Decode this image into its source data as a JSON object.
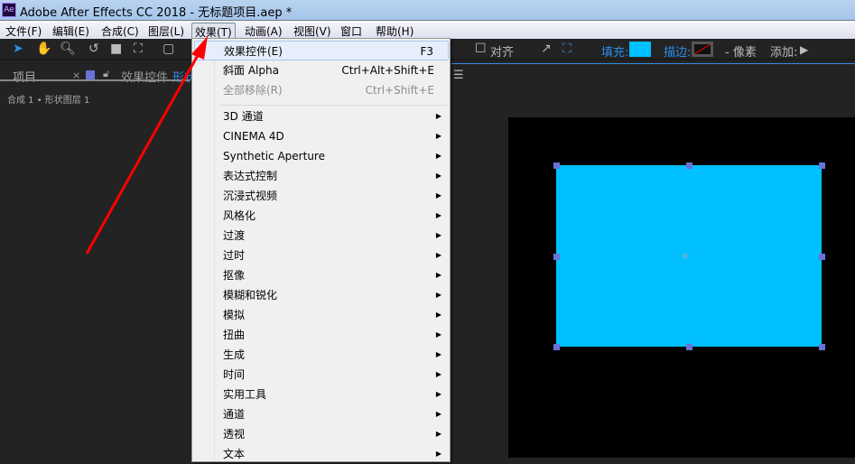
{
  "window": {
    "title": "Adobe After Effects CC 2018 - 无标题项目.aep *",
    "logo": "Ae"
  },
  "menubar": [
    "文件(F)",
    "编辑(E)",
    "合成(C)",
    "图层(L)",
    "效果(T)",
    "动画(A)",
    "视图(V)",
    "窗口",
    "帮助(H)"
  ],
  "toolbar": {
    "snap": "对齐",
    "fill_label": "填充:",
    "stroke_label": "描边:",
    "stroke_unit": "- 像素",
    "add_label": "添加:",
    "fill_color": "#00c0ff"
  },
  "panels": {
    "project_tab": "项目",
    "effects_tab": "效果控件",
    "effects_tab_layer": "形状",
    "breadcrumb": "合成 1 • 形状图层 1"
  },
  "effect_menu": {
    "top": [
      {
        "label": "效果控件(E)",
        "shortcut": "F3"
      },
      {
        "label": "斜面 Alpha",
        "shortcut": "Ctrl+Alt+Shift+E"
      },
      {
        "label": "全部移除(R)",
        "shortcut": "Ctrl+Shift+E",
        "disabled": true
      }
    ],
    "submenus": [
      "3D 通道",
      "CINEMA 4D",
      "Synthetic Aperture",
      "表达式控制",
      "沉浸式视频",
      "风格化",
      "过渡",
      "过时",
      "抠像",
      "模糊和锐化",
      "模拟",
      "扭曲",
      "生成",
      "时间",
      "实用工具",
      "通道",
      "透视",
      "文本"
    ]
  },
  "colors": {
    "shape": "#00c0ff",
    "accent": "#2d8ceb",
    "arrow": "#ff0000"
  }
}
